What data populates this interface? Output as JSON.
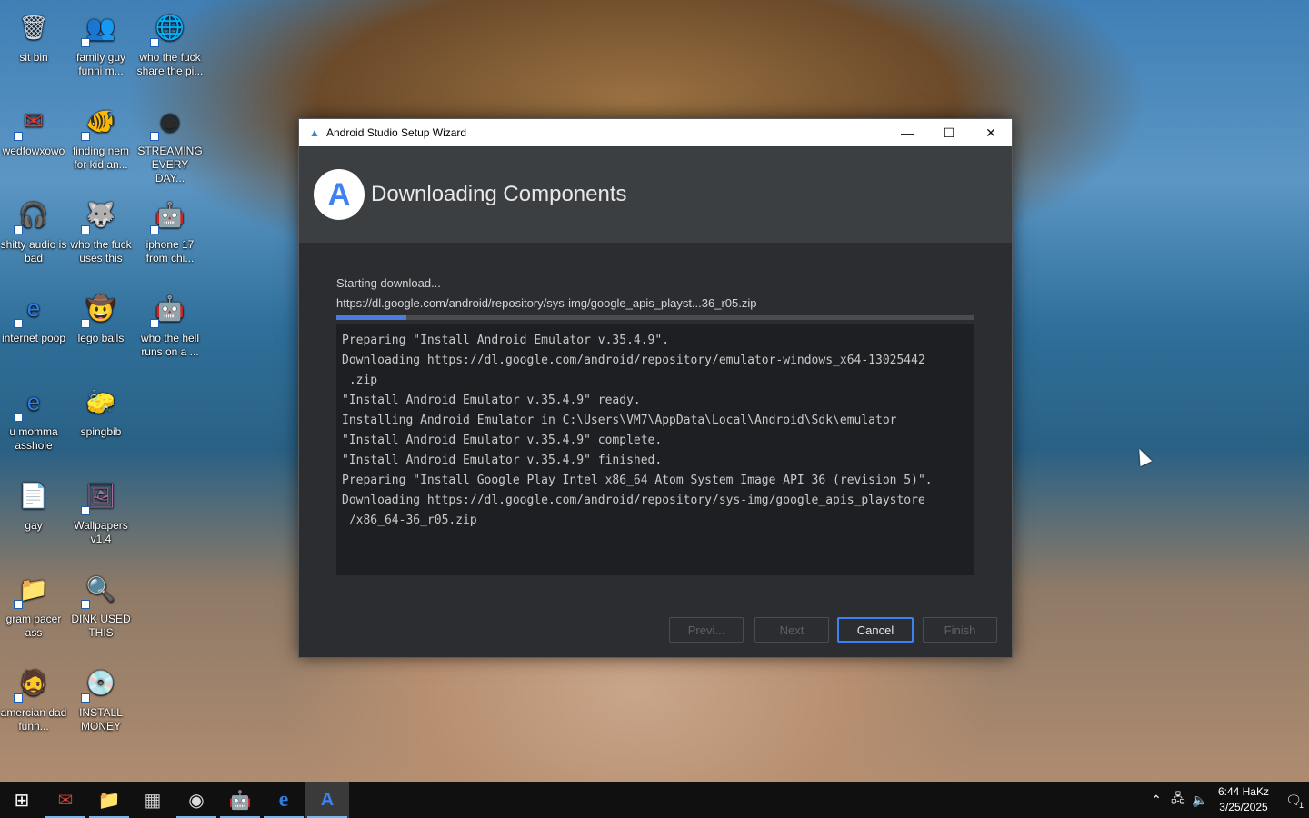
{
  "desktop": {
    "icons": [
      {
        "label": "sit bin",
        "glyph": "🗑",
        "color": "#cfd8e3"
      },
      {
        "label": "family guy funni m...",
        "glyph": "👥",
        "color": "#e8e1d4"
      },
      {
        "label": "who the fuck share the pi...",
        "glyph": "🌐",
        "color": "#5b8fd6"
      },
      {
        "label": "wedfowxowo",
        "glyph": "✉",
        "color": "#d83b2f"
      },
      {
        "label": "finding nem for kid an...",
        "glyph": "🐠",
        "color": "#e26a3d"
      },
      {
        "label": "STREAMING EVERY DAY...",
        "glyph": "◉",
        "color": "#2a2a2a"
      },
      {
        "label": "shitty audio is bad",
        "glyph": "🎧",
        "color": "#2a4fd4"
      },
      {
        "label": "who the fuck uses this",
        "glyph": "🐺",
        "color": "#7c7c7c"
      },
      {
        "label": "iphone 17 from chi...",
        "glyph": "🤖",
        "color": "#8fcf3c"
      },
      {
        "label": "internet poop",
        "glyph": "e",
        "color": "#2e7de1"
      },
      {
        "label": "lego balls",
        "glyph": "🤠",
        "color": "#b0572b"
      },
      {
        "label": "who the hell runs on a ...",
        "glyph": "🤖",
        "color": "#8fcf3c"
      },
      {
        "label": "u momma asshole",
        "glyph": "e",
        "color": "#2e7de1"
      },
      {
        "label": "spingbib",
        "glyph": "🧽",
        "color": "#f2e34a"
      },
      {
        "label": "gay",
        "glyph": "📄",
        "color": "#f4d77a"
      },
      {
        "label": "Wallpapers v1.4",
        "glyph": "🖼",
        "color": "#a56a9d"
      },
      {
        "label": "gram pacer ass",
        "glyph": "📁",
        "color": "#e9c35c"
      },
      {
        "label": "DINK USED THIS",
        "glyph": "🔍",
        "color": "#f28a1e"
      },
      {
        "label": "amercian dad funn...",
        "glyph": "🧔",
        "color": "#c9a47e"
      },
      {
        "label": "INSTALL MONEY",
        "glyph": "💿",
        "color": "#9fc3e8"
      }
    ]
  },
  "window": {
    "title": "Android Studio Setup Wizard",
    "minimize": "—",
    "maximize": "☐",
    "close": "✕",
    "header_title": "Downloading Components",
    "status": "Starting download...",
    "url": "https://dl.google.com/android/repository/sys-img/google_apis_playst...36_r05.zip",
    "progress_fraction": 0.11,
    "log_lines": [
      "Preparing \"Install Android Emulator v.35.4.9\".",
      "Downloading https://dl.google.com/android/repository/emulator-windows_x64-13025442",
      " .zip",
      "\"Install Android Emulator v.35.4.9\" ready.",
      "Installing Android Emulator in C:\\Users\\VM7\\AppData\\Local\\Android\\Sdk\\emulator",
      "\"Install Android Emulator v.35.4.9\" complete.",
      "\"Install Android Emulator v.35.4.9\" finished.",
      "Preparing \"Install Google Play Intel x86_64 Atom System Image API 36 (revision 5)\".",
      "Downloading https://dl.google.com/android/repository/sys-img/google_apis_playstore",
      " /x86_64-36_r05.zip"
    ],
    "buttons": {
      "prev": "Previ...",
      "next": "Next",
      "cancel": "Cancel",
      "finish": "Finish"
    }
  },
  "taskbar": {
    "apps": [
      {
        "name": "start-button",
        "glyph": "⊞",
        "color": "#ffffff"
      },
      {
        "name": "taskbar-wedfowxowo",
        "glyph": "✉",
        "color": "#d83b2f"
      },
      {
        "name": "taskbar-file-explorer",
        "glyph": "📁",
        "color": "#f2c94c"
      },
      {
        "name": "taskbar-app",
        "glyph": "▦",
        "color": "#c9c9c9"
      },
      {
        "name": "taskbar-obs",
        "glyph": "◉",
        "color": "#dddddd"
      },
      {
        "name": "taskbar-android",
        "glyph": "🤖",
        "color": "#8fcf3c"
      },
      {
        "name": "taskbar-internet-explorer",
        "glyph": "e",
        "color": "#2e7de1"
      },
      {
        "name": "taskbar-android-studio",
        "glyph": "A",
        "color": "#3d82f0"
      }
    ],
    "clock_time": "6:44 HaKz",
    "clock_date": "3/25/2025",
    "notification_count": "1"
  }
}
